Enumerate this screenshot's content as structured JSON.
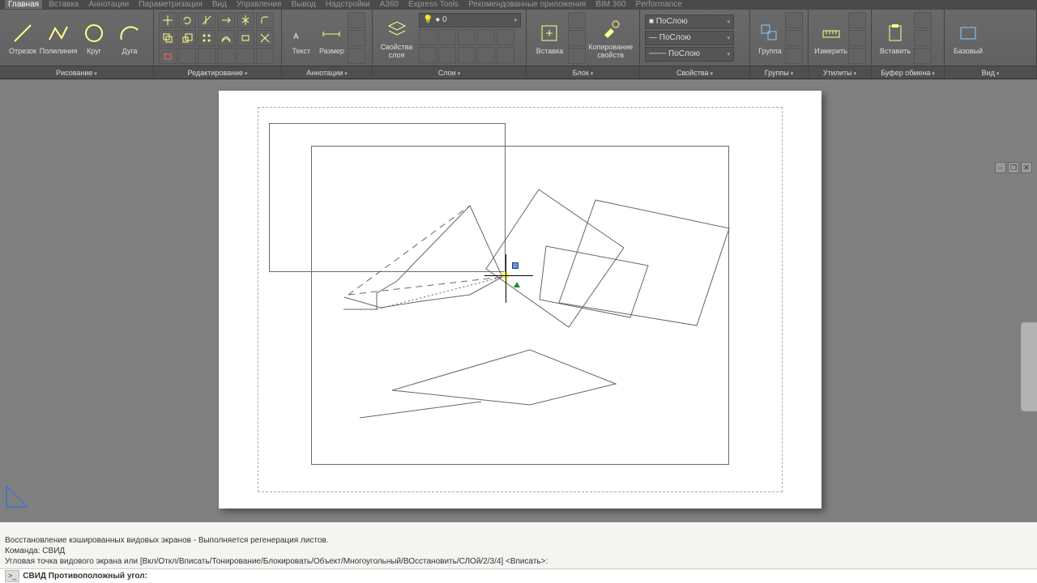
{
  "tabs": {
    "items": [
      "Главная",
      "Вставка",
      "Аннотации",
      "Параметризация",
      "Вид",
      "Управление",
      "Вывод",
      "Надстройки",
      "A360",
      "Express Tools",
      "Рекомендованные приложения",
      "BIM 360",
      "Performance"
    ],
    "active": 0
  },
  "ribbon": {
    "draw": {
      "label": "Рисование",
      "line": "Отрезок",
      "pline": "Полилиния",
      "circle": "Круг",
      "arc": "Дуга"
    },
    "modify": {
      "label": "Редактирование"
    },
    "annot": {
      "label": "Аннотации",
      "text": "Текст",
      "dim": "Размер"
    },
    "layers": {
      "label": "Слои",
      "props": "Свойства\nслоя"
    },
    "block": {
      "label": "Блок",
      "insert": "Вставка",
      "copy": "Копирование\nсвойств"
    },
    "props": {
      "label": "Свойства",
      "bylayer": "ПоСлою"
    },
    "groups": {
      "label": "Группы",
      "group": "Группа"
    },
    "utils": {
      "label": "Утилиты",
      "measure": "Измерить"
    },
    "clip": {
      "label": "Буфер обмена",
      "paste": "Вставить"
    },
    "view": {
      "label": "Вид",
      "base": "Базовый"
    }
  },
  "cmd": {
    "l1": "Восстановление кэшированных видовых экранов - Выполняется регенерация листов.",
    "l2": "Команда: СВИД",
    "l3": "Угловая точка видового экрана или [Вкл/Откл/Вписать/Тонирование/Блокировать/Объект/Многоугольный/ВОсстановить/СЛОй/2/3/4] <Вписать>:",
    "prompt": "СВИД Противоположный угол:"
  },
  "winctrl": {
    "min": "–",
    "max": "❐",
    "close": "✕"
  }
}
